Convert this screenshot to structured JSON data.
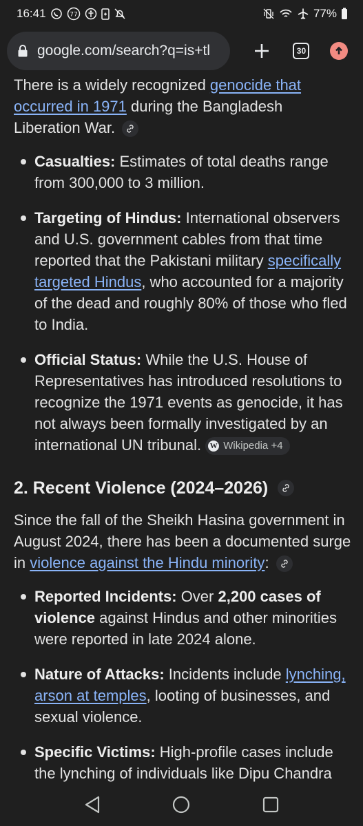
{
  "status_bar": {
    "time": "16:41",
    "notification_icons": [
      "whatsapp-icon",
      "circle-77-icon",
      "accessibility-icon",
      "battery-saver-icon",
      "notifications-off-icon"
    ],
    "right_icons": [
      "vibrate-icon",
      "wifi-icon",
      "airplane-icon"
    ],
    "battery": "77%"
  },
  "browser": {
    "url": "google.com/search?q=is+tl",
    "tab_count": "30"
  },
  "article": {
    "intro": {
      "before": "There is a widely recognized ",
      "link": "genocide that occurred in 1971",
      "after": " during the Bangladesh Liberation War."
    },
    "bullets1": [
      {
        "label": "Casualties:",
        "text": " Estimates of total deaths range from 300,000 to 3 million."
      },
      {
        "label": "Targeting of Hindus:",
        "text_before": " International observers and U.S. government cables from that time reported that the Pakistani military ",
        "link": "specifically targeted Hindus",
        "text_after": ", who accounted for a majority of the dead and roughly 80% of those who fled to India."
      },
      {
        "label": "Official Status:",
        "text": " While the U.S. House of Representatives has introduced resolutions to recognize the 1971 events as genocide, it has not always been formally investigated by an international UN tribunal. "
      }
    ],
    "source_chip": "Wikipedia +4",
    "section2_title": "2. Recent Violence (2024–2026)",
    "para2": {
      "before": "Since the fall of the Sheikh Hasina government in August 2024, there has been a documented surge in ",
      "link": "violence against the Hindu minority",
      "after": ":"
    },
    "bullets2": [
      {
        "label": "Reported Incidents:",
        "text_before": " Over ",
        "bold": "2,200 cases of violence",
        "text_after": " against Hindus and other minorities were reported in late 2024 alone."
      },
      {
        "label": "Nature of Attacks:",
        "text_before": " Incidents include ",
        "link": "lynching, arson at temples",
        "text_after": ", looting of businesses, and sexual violence."
      },
      {
        "label": "Specific Victims:",
        "text": " High-profile cases include the lynching of individuals like Dipu Chandra"
      }
    ]
  },
  "nav": [
    "back-icon",
    "home-icon",
    "recents-icon"
  ]
}
